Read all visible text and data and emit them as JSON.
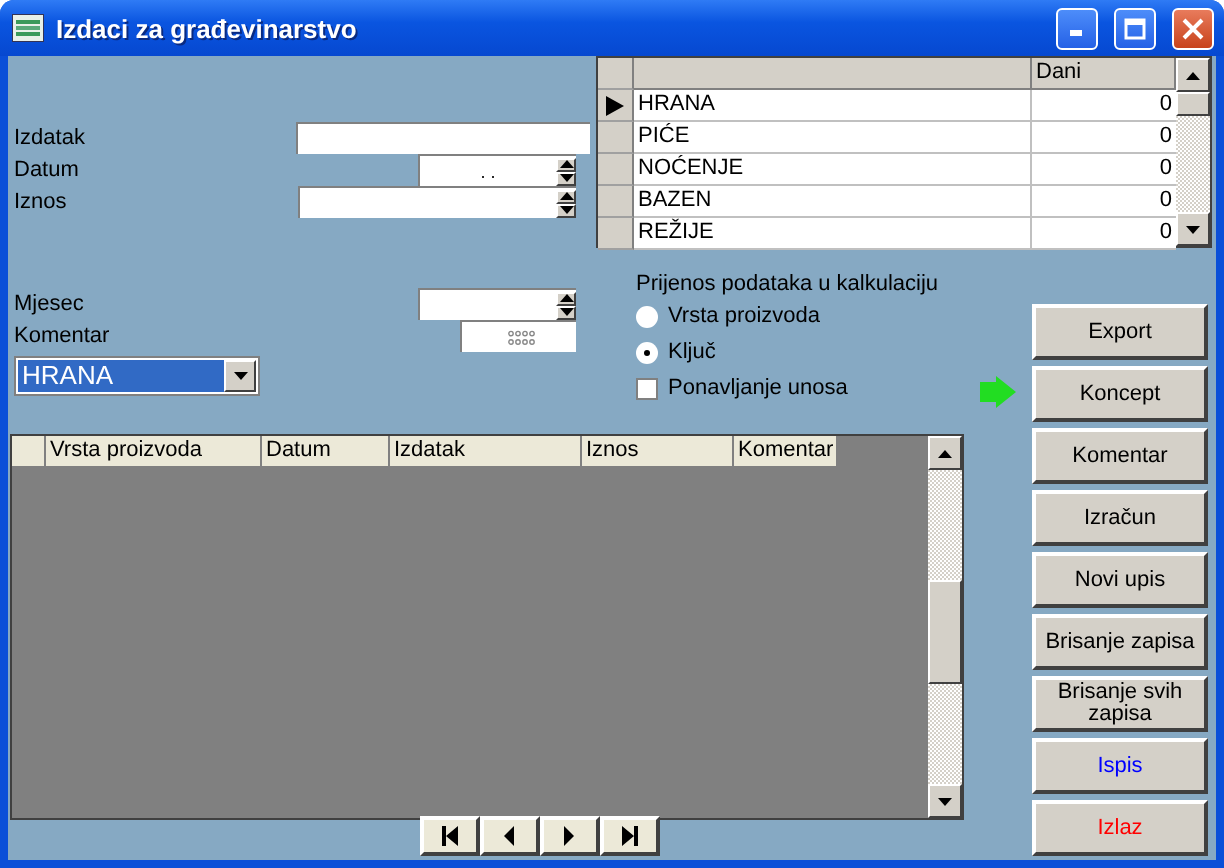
{
  "window": {
    "title": "Izdaci za građevinarstvo"
  },
  "form": {
    "fields": [
      {
        "label": "Izdatak",
        "kind": "text"
      },
      {
        "label": "Datum",
        "kind": "spin",
        "value": ". ."
      },
      {
        "label": "Iznos",
        "kind": "spin-wide"
      }
    ],
    "lower_fields": [
      {
        "label": "Mjesec",
        "kind": "spin"
      },
      {
        "label": "Komentar",
        "kind": "memo"
      }
    ],
    "combo": {
      "value": "HRANA"
    }
  },
  "category_grid": {
    "header": "Dani",
    "rows": [
      {
        "name": "HRANA",
        "dani": "0",
        "selected": true
      },
      {
        "name": "PIĆE",
        "dani": "0",
        "selected": false
      },
      {
        "name": "NOĆENJE",
        "dani": "0",
        "selected": false
      },
      {
        "name": "BAZEN",
        "dani": "0",
        "selected": false
      },
      {
        "name": "REŽIJE",
        "dani": "0",
        "selected": false
      }
    ]
  },
  "transfer": {
    "title": "Prijenos podataka u kalkulaciju",
    "options": [
      {
        "label": "Vrsta proizvoda",
        "selected": false
      },
      {
        "label": "Ključ",
        "selected": true
      }
    ],
    "repeat": {
      "label": "Ponavljanje unosa",
      "checked": false
    }
  },
  "buttons": [
    {
      "label": "Export",
      "color": "#000000"
    },
    {
      "label": "Koncept",
      "color": "#000000"
    },
    {
      "label": "Komentar",
      "color": "#000000"
    },
    {
      "label": "Izračun",
      "color": "#000000"
    },
    {
      "label": "Novi upis",
      "color": "#000000"
    },
    {
      "label": "Brisanje zapisa",
      "color": "#000000"
    },
    {
      "label": "Brisanje svih zapisa",
      "color": "#000000"
    },
    {
      "label": "Ispis",
      "color": "#0000ff"
    },
    {
      "label": "Izlaz",
      "color": "#ff0000"
    }
  ],
  "entries_table": {
    "columns": [
      "Vrsta proizvoda",
      "Datum",
      "Izdatak",
      "Iznos",
      "Komentar"
    ]
  }
}
